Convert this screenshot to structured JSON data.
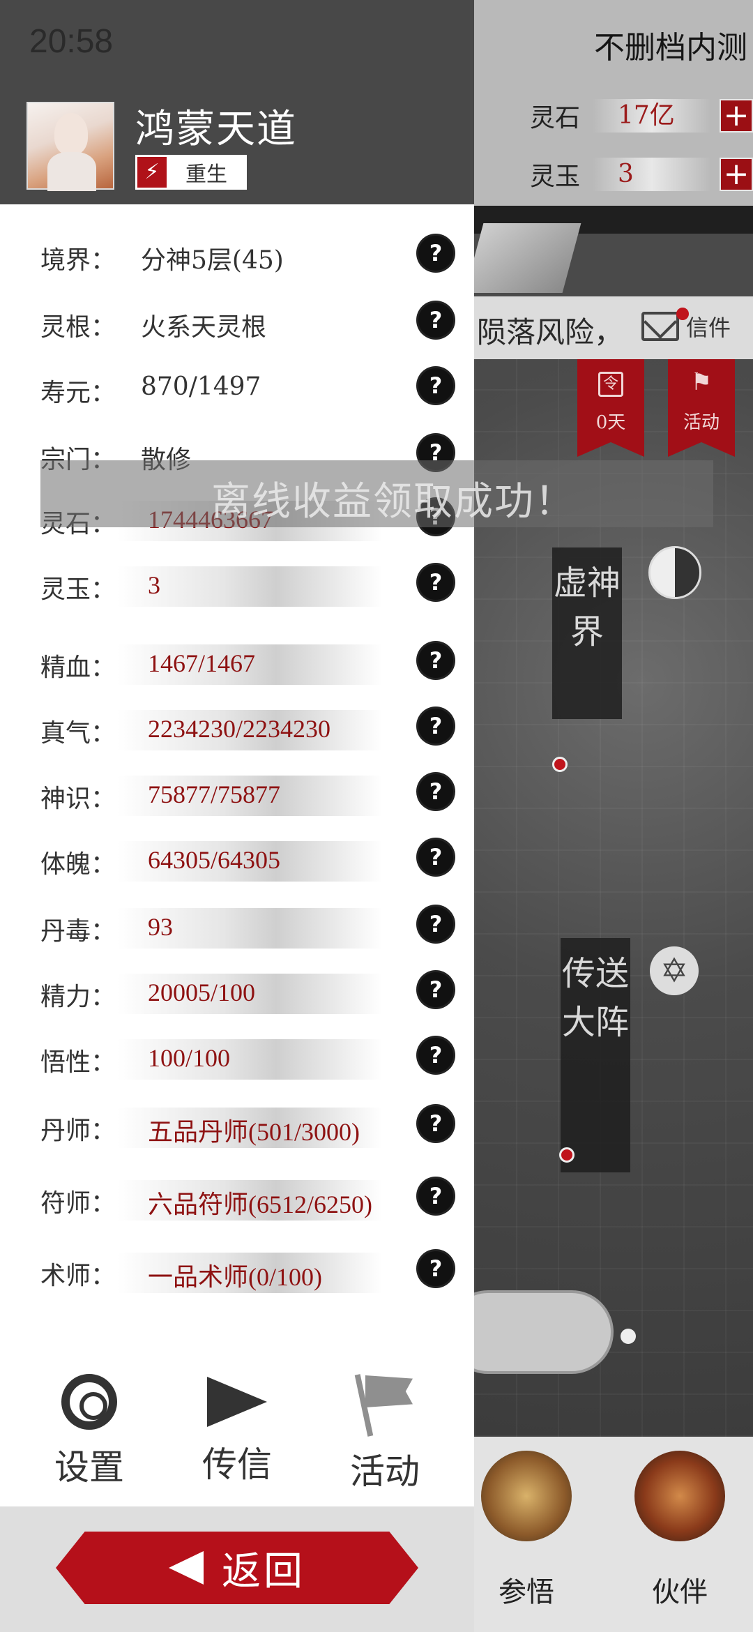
{
  "status_bar": {
    "time": "20:58"
  },
  "profile": {
    "name": "鸿蒙天道",
    "badge_icon": "⚡",
    "badge_label": "重生"
  },
  "stats": [
    {
      "label": "境界：",
      "value": "分神5层(45)",
      "style": "plain"
    },
    {
      "label": "灵根：",
      "value": "火系天灵根",
      "style": "plain"
    },
    {
      "label": "寿元：",
      "value": "870/1497",
      "style": "plain"
    },
    {
      "label": "宗门：",
      "value": "散修",
      "style": "plain"
    },
    {
      "label": "灵石：",
      "value": "1744463667",
      "style": "bar"
    },
    {
      "label": "灵玉：",
      "value": "3",
      "style": "bar"
    },
    {
      "label": "精血：",
      "value": "1467/1467",
      "style": "bar"
    },
    {
      "label": "真气：",
      "value": "2234230/2234230",
      "style": "bar"
    },
    {
      "label": "神识：",
      "value": "75877/75877",
      "style": "bar"
    },
    {
      "label": "体魄：",
      "value": "64305/64305",
      "style": "bar"
    },
    {
      "label": "丹毒：",
      "value": "93",
      "style": "bar"
    },
    {
      "label": "精力：",
      "value": "20005/100",
      "style": "bar"
    },
    {
      "label": "悟性：",
      "value": "100/100",
      "style": "bar"
    },
    {
      "label": "丹师：",
      "value": "五品丹师(501/3000)",
      "style": "bar"
    },
    {
      "label": "符师：",
      "value": "六品符师(6512/6250)",
      "style": "bar"
    },
    {
      "label": "术师：",
      "value": "一品术师(0/100)",
      "style": "bar"
    }
  ],
  "help_glyph": "?",
  "toast": "离线收益领取成功！",
  "actions": {
    "settings": "设置",
    "message": "传信",
    "activity": "活动"
  },
  "return_label": "返回",
  "game": {
    "server_name": "不删档内测",
    "spirit_stone_label": "灵石",
    "spirit_stone_value": "17亿",
    "spirit_jade_label": "灵玉",
    "spirit_jade_value": "3",
    "plus_glyph": "+",
    "notice": "陨落风险，",
    "mail_label": "信件",
    "banner_days": "0天",
    "banner_days_icon": "令",
    "banner_activity": "活动",
    "banner_activity_icon": "⚑",
    "location_1": "虚神界",
    "location_2": "传送大阵",
    "star_glyph": "✡",
    "nav_insight": "参悟",
    "nav_partner": "伙伴"
  },
  "colors": {
    "accent_red": "#b5101a",
    "value_red": "#8e1212",
    "header_gray": "#484848"
  }
}
